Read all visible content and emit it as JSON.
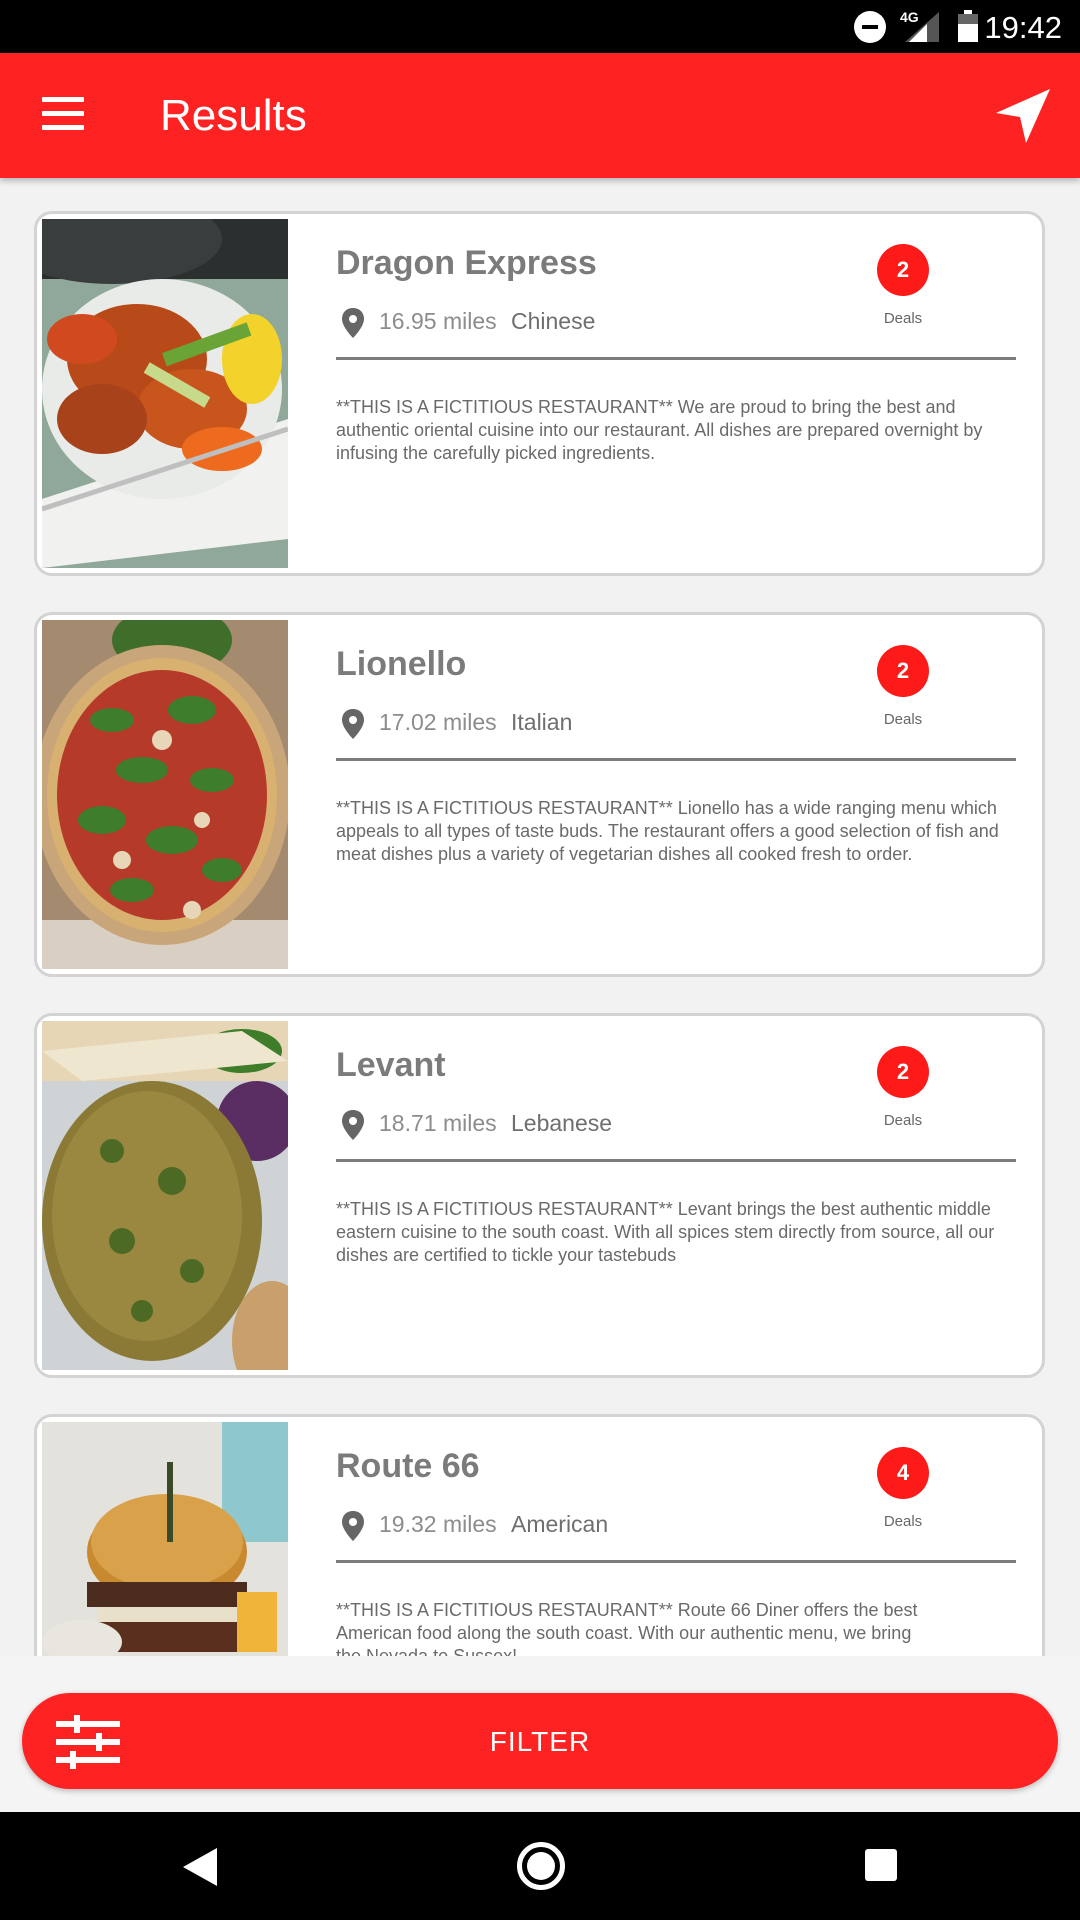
{
  "status_bar": {
    "time": "19:42",
    "network": "4G",
    "icons": [
      "do-not-disturb-icon",
      "cell-signal-icon",
      "battery-icon"
    ]
  },
  "app_bar": {
    "title": "Results",
    "menu_icon": "hamburger-menu-icon",
    "action_icon": "navigation-arrow-icon"
  },
  "colors": {
    "primary": "#ff2222",
    "badge": "#ff1a1a",
    "card_border": "#d3d3d3",
    "text_dark": "#7b7b7b"
  },
  "restaurants": [
    {
      "name": "Dragon Express",
      "distance": "16.95 miles",
      "cuisine": "Chinese",
      "deals_count": "2",
      "deals_label": "Deals",
      "description": "**THIS IS A FICTITIOUS RESTAURANT** We are proud to bring the best and authentic oriental cuisine into our restaurant. All dishes are prepared overnight by infusing the carefully picked ingredients."
    },
    {
      "name": "Lionello",
      "distance": "17.02 miles",
      "cuisine": "Italian",
      "deals_count": "2",
      "deals_label": "Deals",
      "description": "**THIS IS A FICTITIOUS RESTAURANT** Lionello has a wide ranging menu which appeals to all types of taste buds. The restaurant offers a good selection of fish and meat dishes plus a variety of vegetarian dishes all cooked fresh to order."
    },
    {
      "name": "Levant",
      "distance": "18.71 miles",
      "cuisine": "Lebanese",
      "deals_count": "2",
      "deals_label": "Deals",
      "description": "**THIS IS A FICTITIOUS RESTAURANT**  Levant brings the best authentic middle eastern cuisine to the south coast. With all spices stem directly from source, all our dishes are certified to tickle your tastebuds"
    },
    {
      "name": "Route 66",
      "distance": "19.32 miles",
      "cuisine": "American",
      "deals_count": "4",
      "deals_label": "Deals",
      "description": "**THIS IS A FICTITIOUS RESTAURANT** Route 66 Diner offers the best American food along the south coast. With our authentic menu, we bring the Nevada to Sussex!"
    }
  ],
  "filter": {
    "label": "FILTER",
    "icon": "sliders-icon"
  },
  "nav_bar": {
    "icons": [
      "back-icon",
      "home-icon",
      "recents-icon"
    ]
  }
}
